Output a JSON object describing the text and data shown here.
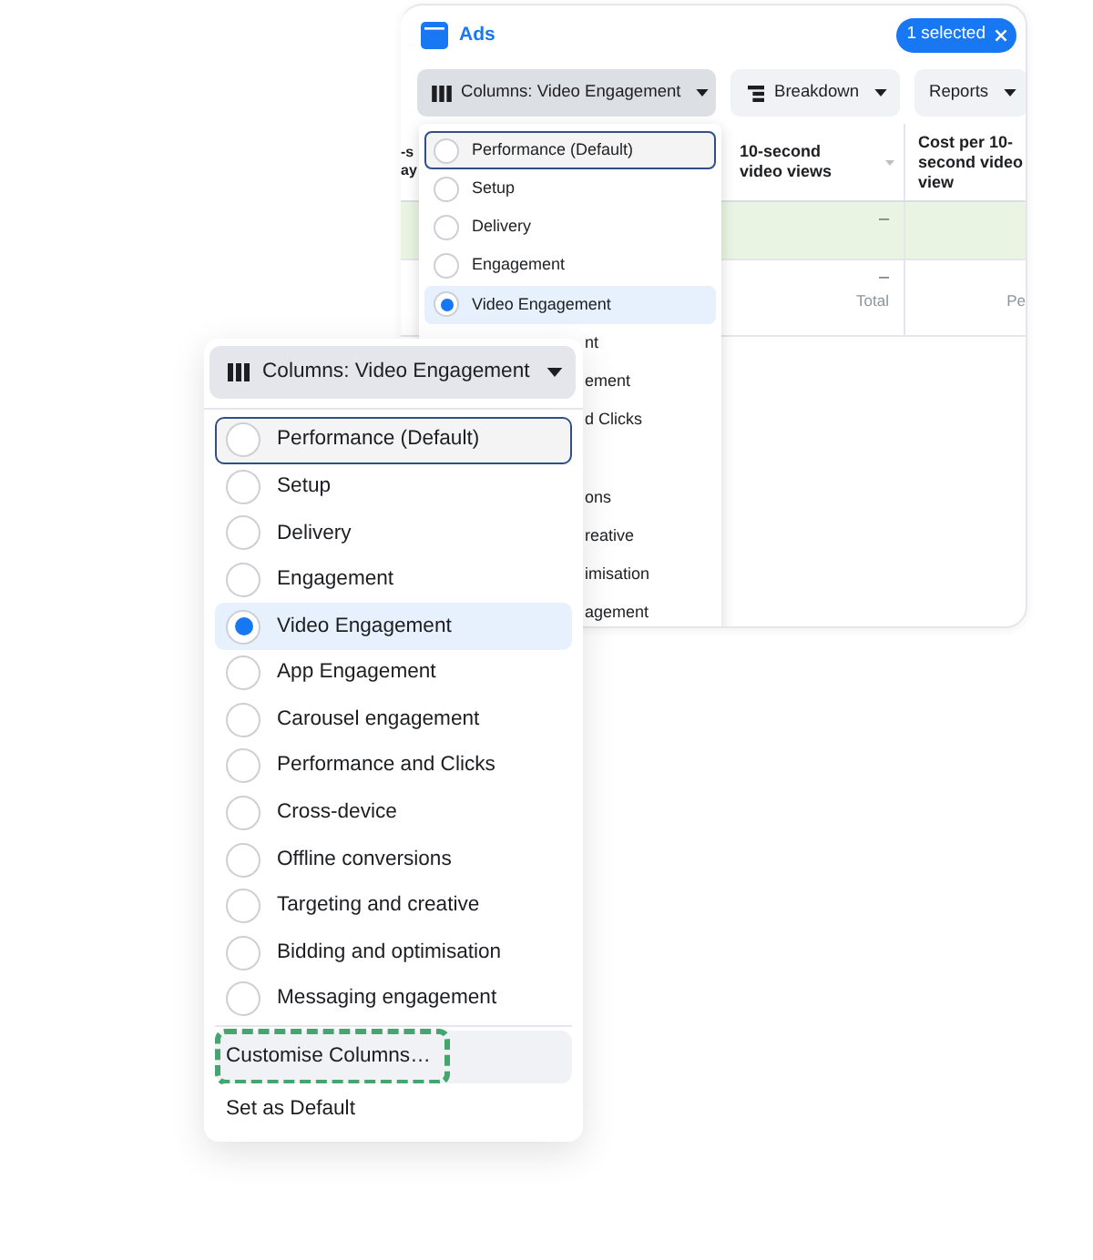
{
  "back_window": {
    "title": "Ads",
    "selection_badge": {
      "label": "1 selected"
    },
    "toolbar": [
      {
        "kind": "columns",
        "label": "Columns: Video Engagement",
        "pressed": true
      },
      {
        "kind": "breakdown",
        "label": "Breakdown",
        "pressed": false
      },
      {
        "kind": "reports",
        "label": "Reports",
        "pressed": false
      }
    ],
    "table": {
      "columns": [
        {
          "heading": "-s ay"
        },
        {
          "heading": "10-second video views"
        },
        {
          "heading": "Cost per 10-second video view"
        }
      ],
      "rows": [
        {
          "highlighted": true,
          "column_2": {
            "value": "–"
          }
        },
        {
          "highlighted": false,
          "column_2": {
            "value": "–",
            "caption": "Total"
          },
          "column_3": {
            "caption": "Pe"
          }
        }
      ]
    },
    "menu": {
      "options": [
        {
          "label": "Performance (Default)",
          "selected": false,
          "focused": true
        },
        {
          "label": "Setup",
          "selected": false,
          "focused": false
        },
        {
          "label": "Delivery",
          "selected": false,
          "focused": false
        },
        {
          "label": "Engagement",
          "selected": false,
          "focused": false
        },
        {
          "label": "Video Engagement",
          "selected": true,
          "focused": false
        }
      ],
      "covered_fragments": [
        [
          "nt",
          "ement",
          "d Clicks"
        ],
        [
          "ons",
          "reative",
          "imisation",
          "agement"
        ]
      ]
    }
  },
  "front_panel": {
    "columns_button": {
      "label": "Columns: Video Engagement",
      "pressed": true
    },
    "options": [
      {
        "label": "Performance (Default)",
        "selected": false,
        "focused": true
      },
      {
        "label": "Setup",
        "selected": false,
        "focused": false
      },
      {
        "label": "Delivery",
        "selected": false,
        "focused": false
      },
      {
        "label": "Engagement",
        "selected": false,
        "focused": false
      },
      {
        "label": "Video Engagement",
        "selected": true,
        "focused": false
      },
      {
        "label": "App Engagement",
        "selected": false,
        "focused": false
      },
      {
        "label": "Carousel engagement",
        "selected": false,
        "focused": false
      },
      {
        "label": "Performance and Clicks",
        "selected": false,
        "focused": false
      },
      {
        "label": "Cross-device",
        "selected": false,
        "focused": false
      },
      {
        "label": "Offline conversions",
        "selected": false,
        "focused": false
      },
      {
        "label": "Targeting and creative",
        "selected": false,
        "focused": false
      },
      {
        "label": "Bidding and optimisation",
        "selected": false,
        "focused": false
      },
      {
        "label": "Messaging engagement",
        "selected": false,
        "focused": false
      }
    ],
    "actions": [
      {
        "label": "Customise Columns…",
        "hovered": true,
        "outlined": true
      },
      {
        "label": "Set as Default",
        "hovered": false,
        "outlined": false
      }
    ]
  }
}
